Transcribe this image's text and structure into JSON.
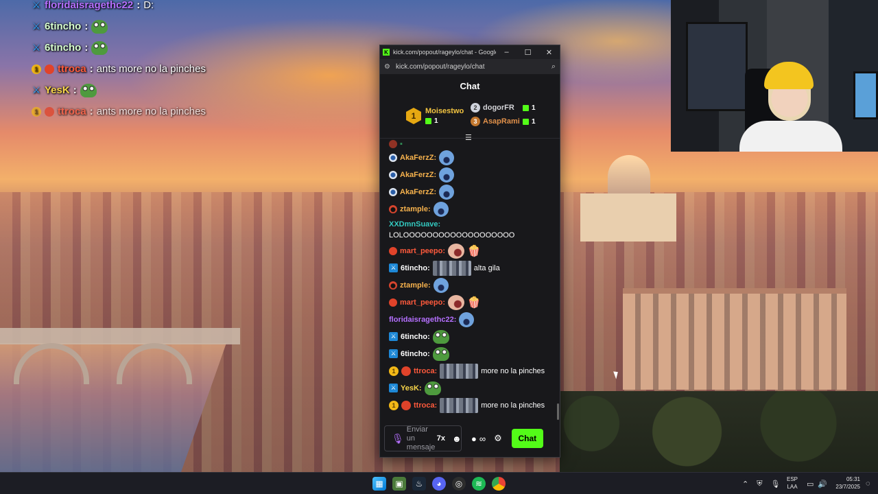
{
  "overlay_chat": [
    {
      "badge": "sword",
      "user": "floridaisragethc22",
      "user_color": "#b570ff",
      "message": "D:",
      "emote": ""
    },
    {
      "badge": "sword",
      "user": "6tincho",
      "user_color": "#d8ffd0",
      "message": "",
      "emote": "pepe"
    },
    {
      "badge": "sword",
      "user": "6tincho",
      "user_color": "#d8ffd0",
      "message": "",
      "emote": "pepe"
    },
    {
      "badge": "gold",
      "user": "ttroca",
      "user_color": "#ff5a3c",
      "message": "ants more no la pinches",
      "emote": ""
    },
    {
      "badge": "sword",
      "user": "YesK",
      "user_color": "#f7d44a",
      "message": "",
      "emote": "pepe"
    },
    {
      "badge": "gold",
      "user": "ttroca",
      "user_color": "#ff5a3c",
      "message": "ants more no la pinches",
      "emote": ""
    }
  ],
  "window": {
    "title": "kick.com/popout/rageylo/chat - Google C...",
    "url": "kick.com/popout/rageylo/chat",
    "minimize": "–",
    "maximize": "☐",
    "close": "✕"
  },
  "chat": {
    "header": "Chat",
    "leaderboard": {
      "first": {
        "rank": "1",
        "name": "Moisestwo",
        "count": "1"
      },
      "second": {
        "rank": "2",
        "name": "dogorFR",
        "count": "1"
      },
      "third": {
        "rank": "3",
        "name": "AsapRami",
        "count": "1"
      }
    },
    "messages": [
      {
        "user": "AkaFerzZ:",
        "color": "c-orange",
        "avatar": "av-blue",
        "text": "",
        "emote": "blob"
      },
      {
        "user": "AkaFerzZ:",
        "color": "c-orange",
        "avatar": "av-blue",
        "text": "",
        "emote": "blob"
      },
      {
        "user": "AkaFerzZ:",
        "color": "c-orange",
        "avatar": "av-blue",
        "text": "",
        "emote": "blob"
      },
      {
        "user": "ztample:",
        "color": "c-orange",
        "avatar": "av-skull",
        "text": "",
        "emote": "blob"
      },
      {
        "user": "XXDmnSuave:",
        "color": "c-teal",
        "avatar": "",
        "text": "LOLOOOOOOOOOOOOOOOOOOO",
        "emote": ""
      },
      {
        "user": "mart_peepo:",
        "color": "c-red",
        "avatar": "av-red",
        "text": "",
        "emote": "face"
      },
      {
        "user": "6tincho:",
        "color": "c-white",
        "avatar": "sword",
        "text": "alta gila",
        "emote": "crowd"
      },
      {
        "user": "ztample:",
        "color": "c-orange",
        "avatar": "av-skull",
        "text": "",
        "emote": "blob"
      },
      {
        "user": "mart_peepo:",
        "color": "c-red",
        "avatar": "av-red",
        "text": "",
        "emote": "face"
      },
      {
        "user": "floridaisragethc22:",
        "color": "c-purple",
        "avatar": "",
        "text": "",
        "emote": "blob"
      },
      {
        "user": "6tincho:",
        "color": "c-white",
        "avatar": "sword",
        "text": "",
        "emote": "pepe"
      },
      {
        "user": "6tincho:",
        "color": "c-white",
        "avatar": "sword",
        "text": "",
        "emote": "pepe"
      },
      {
        "user": "ttroca:",
        "color": "c-red",
        "avatar": "gold",
        "text": "more no la pinches",
        "emote": "crowd"
      },
      {
        "user": "YesK:",
        "color": "c-yellow",
        "avatar": "sword",
        "text": "",
        "emote": "pepe"
      },
      {
        "user": "ttroca:",
        "color": "c-red",
        "avatar": "gold",
        "text": "more no la pinches",
        "emote": "crowd"
      }
    ],
    "input_placeholder": "Enviar un mensaje",
    "send_button": "Chat"
  },
  "taskbar": {
    "language_top": "ESP",
    "language_bottom": "LAA",
    "time": "05:31",
    "date": "23/7/2025"
  },
  "colors": {
    "kick_green": "#53fc18",
    "chat_bg": "#18181b",
    "taskbar_bg": "#1c1d24"
  }
}
